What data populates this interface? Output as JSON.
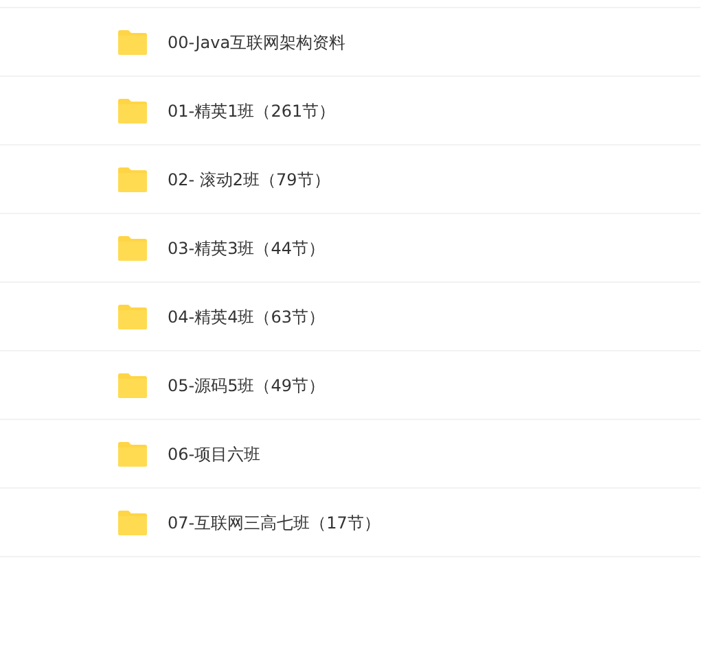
{
  "folders": [
    {
      "name": "00-Java互联网架构资料"
    },
    {
      "name": "01-精英1班（261节）"
    },
    {
      "name": "02- 滚动2班（79节）"
    },
    {
      "name": "03-精英3班（44节）"
    },
    {
      "name": "04-精英4班（63节）"
    },
    {
      "name": "05-源码5班（49节）"
    },
    {
      "name": "06-项目六班"
    },
    {
      "name": "07-互联网三高七班（17节）"
    }
  ]
}
